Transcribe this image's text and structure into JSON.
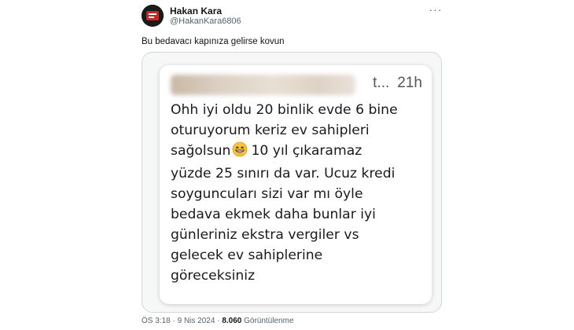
{
  "author": {
    "name": "Hakan Kara",
    "handle": "@HakanKara6806"
  },
  "tweet": {
    "text": "Bu bedavacı kapınıza gelirse kovun"
  },
  "card": {
    "time_prefix": "t...",
    "time_ago": "21h",
    "lines": [
      "Ohh iyi oldu 20 binlik evde 6 bine",
      "oturuyorum keriz ev sahipleri",
      "sağolsun",
      "10 yıl çıkaramaz",
      "yüzde 25 sınırı da var. Ucuz kredi",
      "soyguncuları sizi var mı öyle",
      "bedava ekmek daha bunlar iyi",
      "günleriniz ekstra vergiler vs",
      "gelecek ev sahiplerine",
      "göreceksiniz"
    ],
    "emoji_icon": "grinning-face-icon"
  },
  "footer": {
    "time": "ÖS 3:18",
    "separator": "·",
    "date": "9 Nis 2024",
    "views_count": "8.060",
    "views_label": "Görüntülenme"
  },
  "colors": {
    "text": "#0f1419",
    "muted": "#536471",
    "border": "#cfd9de"
  }
}
